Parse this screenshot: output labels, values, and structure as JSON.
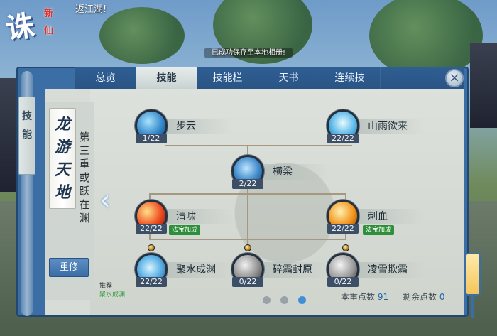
{
  "header": {
    "message": "返江湖!",
    "toast": "已成功保存至本地相册!",
    "logo_main": "诛",
    "logo_small_1": "新",
    "logo_small_2": "仙"
  },
  "tabs": [
    {
      "label": "总览",
      "active": false
    },
    {
      "label": "技能",
      "active": true
    },
    {
      "label": "技能栏",
      "active": false
    },
    {
      "label": "天书",
      "active": false
    },
    {
      "label": "连续技",
      "active": false
    }
  ],
  "side_tab": "技能",
  "close_icon": "close-icon",
  "left_panel": {
    "scroll_title": "龙游天地",
    "tier_label": "第三重或跃在渊",
    "reset_button": "重修",
    "recommend_label": "推荐",
    "recommend_skill": "聚水成渊"
  },
  "skills": {
    "buyun": {
      "name": "步云",
      "level": "1/22"
    },
    "shanyuyulai": {
      "name": "山雨欲来",
      "level": "22/22"
    },
    "hengliang": {
      "name": "横梁",
      "level": "2/22"
    },
    "qingxiao": {
      "name": "清啸",
      "level": "22/22",
      "badge": "法宝加成"
    },
    "cixue": {
      "name": "刺血",
      "level": "22/22",
      "badge": "法宝加成"
    },
    "jushuichengyuan": {
      "name": "聚水成渊",
      "level": "22/22"
    },
    "suishuangfengyuan": {
      "name": "碎霜封原",
      "level": "0/22"
    },
    "lingxueqishuang": {
      "name": "凌雪欺霜",
      "level": "0/22"
    }
  },
  "points": {
    "current_label": "本重点数",
    "current_value": "91",
    "remaining_label": "剩余点数",
    "remaining_value": "0"
  },
  "pagination": {
    "count": 3,
    "active_index": 2
  },
  "colors": {
    "accent": "#3b6ea5",
    "badge_green": "#2e8f3a",
    "page_dot_active": "#3f8fd8"
  }
}
